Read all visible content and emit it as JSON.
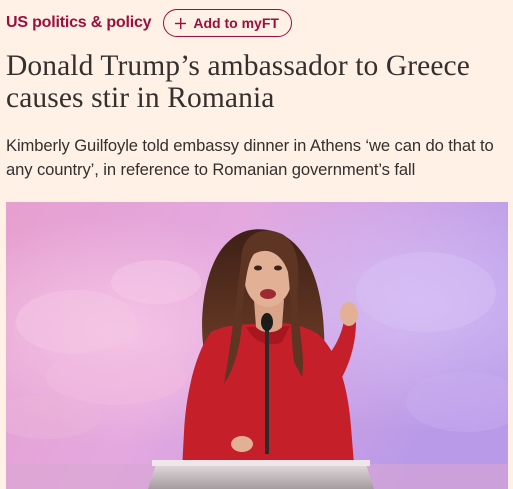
{
  "topic": {
    "label": "US politics & policy"
  },
  "myft_button": {
    "label": "Add to myFT",
    "icon": "plus-icon"
  },
  "headline": "Donald Trump’s ambassador to Greece causes stir in Romania",
  "standfirst": "Kimberly Guilfoyle told embassy dinner in Athens ‘we can do that to any country’, in reference to Romanian government’s fall",
  "image": {
    "subject": "speaker-at-podium",
    "colors": {
      "background_pink": "#e9a3d4",
      "background_lavender": "#c7a8ec",
      "dress_red": "#c8202a",
      "hair_brown": "#5a3222",
      "podium_silver": "#c9c2c4"
    }
  },
  "colors": {
    "page_background": "#fff1e5",
    "accent_claret": "#990f3d",
    "text": "#33302e"
  }
}
